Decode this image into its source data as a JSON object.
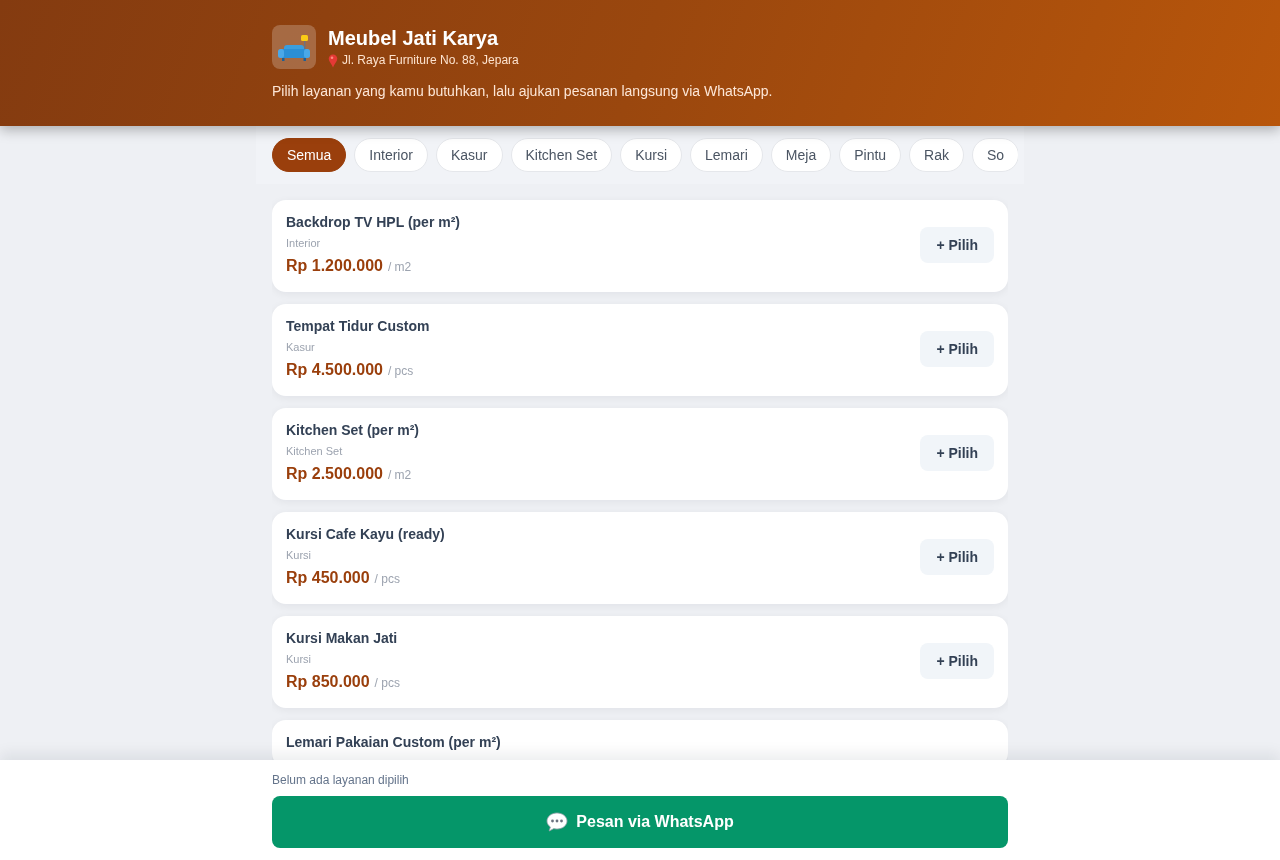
{
  "header": {
    "title": "Meubel Jati Karya",
    "address": "Jl. Raya Furniture No. 88, Jepara",
    "tagline": "Pilih layanan yang kamu butuhkan, lalu ajukan pesanan langsung via WhatsApp."
  },
  "categories": [
    {
      "label": "Semua",
      "selected": true
    },
    {
      "label": "Interior",
      "selected": false
    },
    {
      "label": "Kasur",
      "selected": false
    },
    {
      "label": "Kitchen Set",
      "selected": false
    },
    {
      "label": "Kursi",
      "selected": false
    },
    {
      "label": "Lemari",
      "selected": false
    },
    {
      "label": "Meja",
      "selected": false
    },
    {
      "label": "Pintu",
      "selected": false
    },
    {
      "label": "Rak",
      "selected": false
    },
    {
      "label": "So",
      "selected": false
    }
  ],
  "services": [
    {
      "name": "Backdrop TV HPL (per m²)",
      "category": "Interior",
      "price": "Rp 1.200.000",
      "unit": "/ m2",
      "button": "+ Pilih"
    },
    {
      "name": "Tempat Tidur Custom",
      "category": "Kasur",
      "price": "Rp 4.500.000",
      "unit": "/ pcs",
      "button": "+ Pilih"
    },
    {
      "name": "Kitchen Set (per m²)",
      "category": "Kitchen Set",
      "price": "Rp 2.500.000",
      "unit": "/ m2",
      "button": "+ Pilih"
    },
    {
      "name": "Kursi Cafe Kayu (ready)",
      "category": "Kursi",
      "price": "Rp 450.000",
      "unit": "/ pcs",
      "button": "+ Pilih"
    },
    {
      "name": "Kursi Makan Jati",
      "category": "Kursi",
      "price": "Rp 850.000",
      "unit": "/ pcs",
      "button": "+ Pilih"
    },
    {
      "name": "Lemari Pakaian Custom (per m²)"
    }
  ],
  "footer": {
    "status": "Belum ada layanan dipilih",
    "button": "Pesan via WhatsApp"
  }
}
